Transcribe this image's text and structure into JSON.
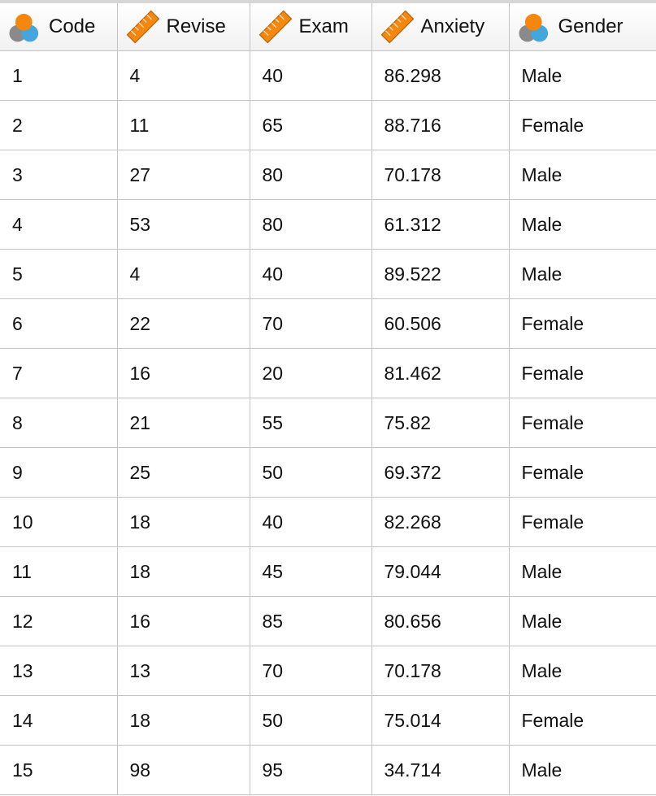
{
  "columns": [
    {
      "label": "Code",
      "icon": "nominal-variable-icon"
    },
    {
      "label": "Revise",
      "icon": "scale-variable-icon"
    },
    {
      "label": "Exam",
      "icon": "scale-variable-icon"
    },
    {
      "label": "Anxiety",
      "icon": "scale-variable-icon"
    },
    {
      "label": "Gender",
      "icon": "nominal-variable-icon"
    }
  ],
  "colors": {
    "orange": "#f5870f",
    "blue": "#43a6dd",
    "gray": "#8a8a8a"
  },
  "rows": [
    [
      "1",
      "4",
      "40",
      "86.298",
      "Male"
    ],
    [
      "2",
      "11",
      "65",
      "88.716",
      "Female"
    ],
    [
      "3",
      "27",
      "80",
      "70.178",
      "Male"
    ],
    [
      "4",
      "53",
      "80",
      "61.312",
      "Male"
    ],
    [
      "5",
      "4",
      "40",
      "89.522",
      "Male"
    ],
    [
      "6",
      "22",
      "70",
      "60.506",
      "Female"
    ],
    [
      "7",
      "16",
      "20",
      "81.462",
      "Female"
    ],
    [
      "8",
      "21",
      "55",
      "75.82",
      "Female"
    ],
    [
      "9",
      "25",
      "50",
      "69.372",
      "Female"
    ],
    [
      "10",
      "18",
      "40",
      "82.268",
      "Female"
    ],
    [
      "11",
      "18",
      "45",
      "79.044",
      "Male"
    ],
    [
      "12",
      "16",
      "85",
      "80.656",
      "Male"
    ],
    [
      "13",
      "13",
      "70",
      "70.178",
      "Male"
    ],
    [
      "14",
      "18",
      "50",
      "75.014",
      "Female"
    ],
    [
      "15",
      "98",
      "95",
      "34.714",
      "Male"
    ]
  ]
}
